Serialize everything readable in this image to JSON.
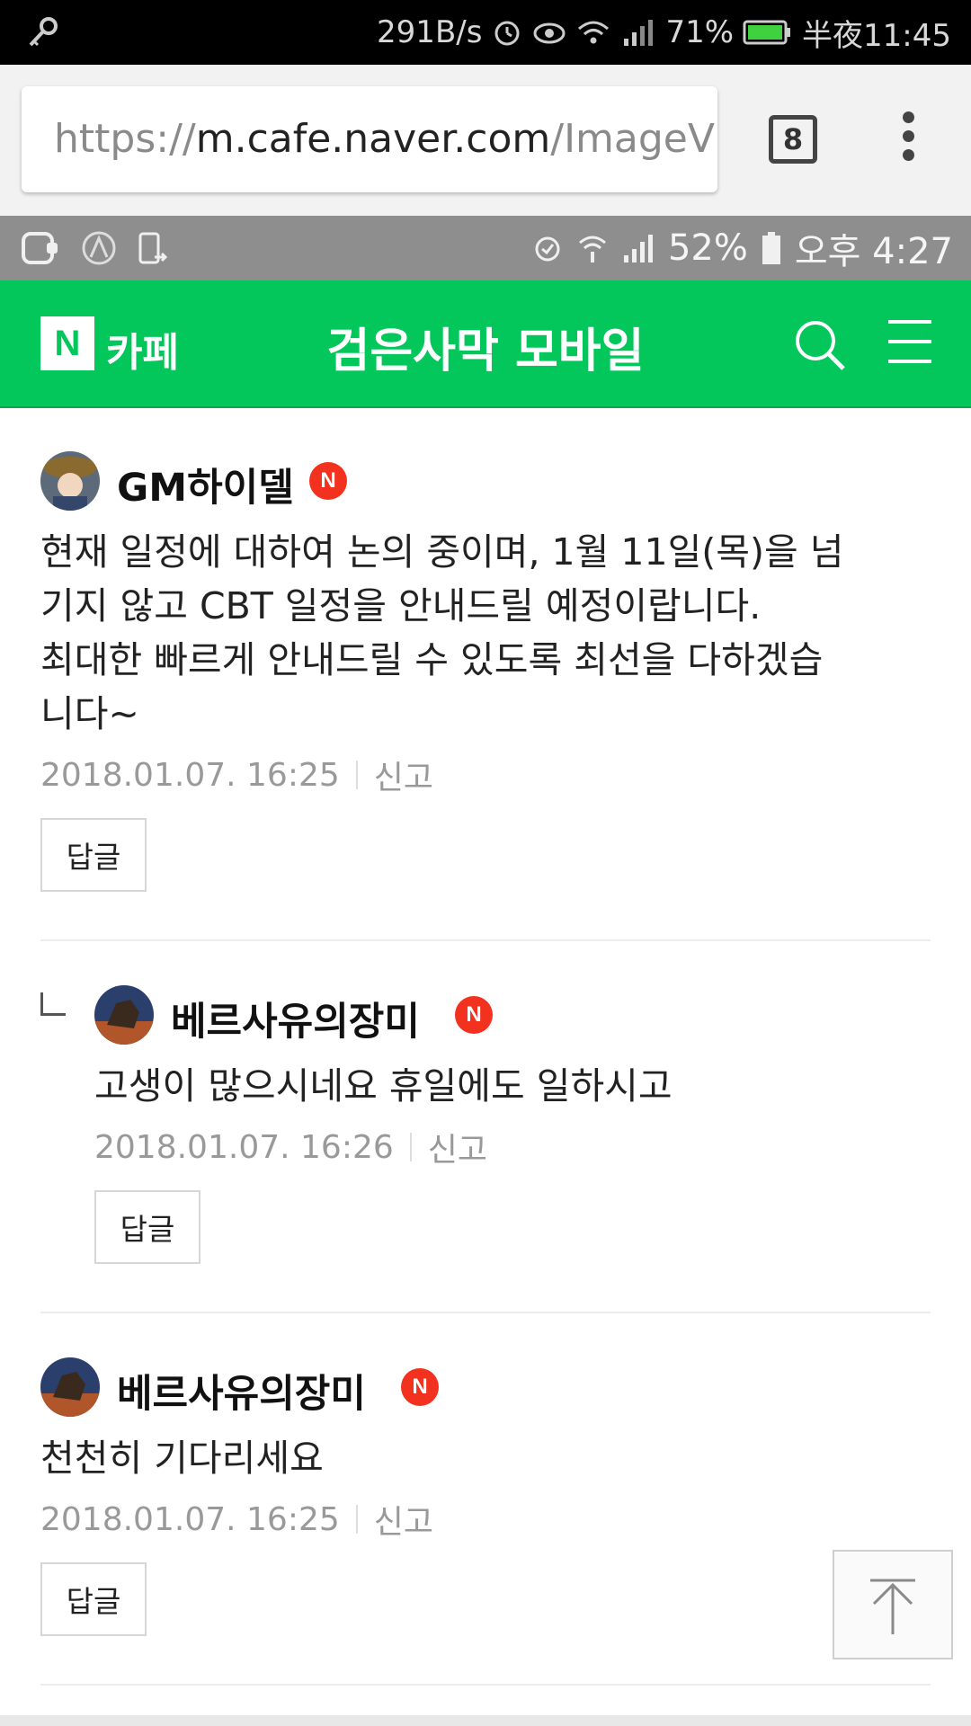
{
  "status_bar": {
    "net_speed": "291B/s",
    "battery": "71%",
    "time": "半夜11:45"
  },
  "browser": {
    "url_scheme": "https://",
    "url_host": "m.cafe.naver.com",
    "url_path": "/ImageV",
    "tab_count": "8"
  },
  "inner_status": {
    "battery": "52%",
    "time": "오후 4:27"
  },
  "cafe": {
    "logo": "N",
    "label": "카페",
    "title": "검은사막 모바일"
  },
  "comments": [
    {
      "author": "GM하이델",
      "badge": "N",
      "lines": [
        "현재 일정에 대하여 논의 중이며, 1월 11일(목)을 넘",
        "기지 않고 CBT 일정을 안내드릴 예정이랍니다.",
        "최대한 빠르게 안내드릴 수 있도록 최선을 다하겠습",
        "니다~"
      ],
      "date": "2018.01.07. 16:25",
      "report": "신고",
      "reply": "답글"
    },
    {
      "author": "베르사유의장미",
      "badge": "N",
      "lines": [
        "고생이 많으시네요 휴일에도 일하시고"
      ],
      "date": "2018.01.07. 16:26",
      "report": "신고",
      "reply": "답글"
    },
    {
      "author": "베르사유의장미",
      "badge": "N",
      "lines": [
        "천천히 기다리세요"
      ],
      "date": "2018.01.07. 16:25",
      "report": "신고",
      "reply": "답글"
    }
  ],
  "icons": {
    "key": "key-icon",
    "alarm": "alarm-icon",
    "eye": "eye-icon",
    "wifi": "wifi-icon",
    "signal": "signal-icon",
    "battery": "battery-icon",
    "search": "search-icon",
    "menu": "hamburger-menu-icon",
    "scroll_top": "arrow-up-icon"
  },
  "colors": {
    "cafe_green": "#03c75a",
    "badge_red": "#f2311e"
  }
}
